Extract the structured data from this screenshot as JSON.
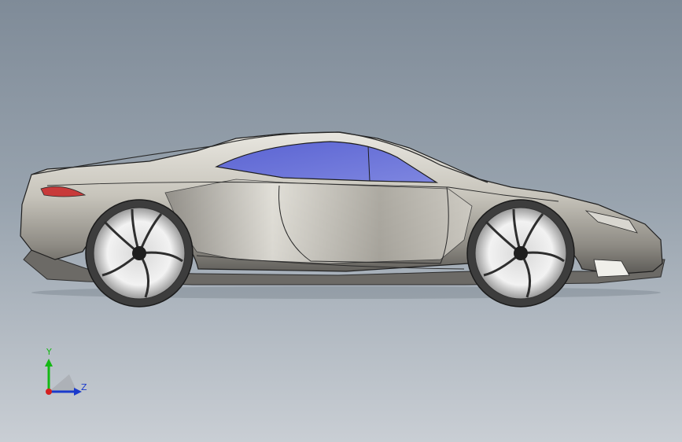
{
  "viewport": {
    "background_top": "#7f8b98",
    "background_bottom": "#c9ced4"
  },
  "model": {
    "name": "sports-car-side-view",
    "body_color": "#b9b6ad",
    "window_color": "#6a72d6",
    "taillight_color": "#c83a3a"
  },
  "triad": {
    "y_label": "Y",
    "z_label": "Z",
    "y_color": "#14b814",
    "z_color": "#1a3acc",
    "x_color": "#d42020"
  }
}
